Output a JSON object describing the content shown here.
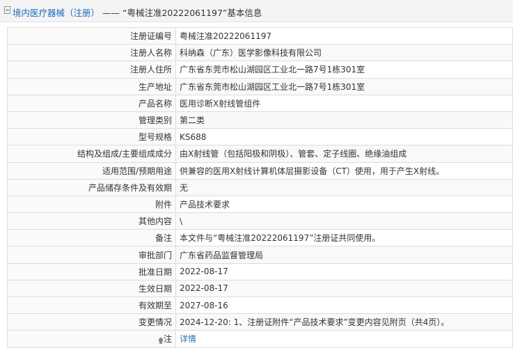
{
  "header": {
    "crumb_main": "境内医疗器械（注册）",
    "crumb_sep": " —— ",
    "crumb_sub": "“粤械注准20222061197”基本信息"
  },
  "rows": [
    {
      "label": "注册证编号",
      "value": "粤械注准20222061197"
    },
    {
      "label": "注册人名称",
      "value": "科纳森（广东）医学影像科技有限公司"
    },
    {
      "label": "注册人住所",
      "value": "广东省东莞市松山湖园区工业北一路7号1栋301室"
    },
    {
      "label": "生产地址",
      "value": "广东省东莞市松山湖园区工业北一路7号1栋301室"
    },
    {
      "label": "产品名称",
      "value": "医用诊断X射线管组件"
    },
    {
      "label": "管理类别",
      "value": "第二类"
    },
    {
      "label": "型号规格",
      "value": "KS688"
    },
    {
      "label": "结构及组成/主要组成成分",
      "value": "由X射线管（包括阳极和阴极）、管套、定子线圈、绝缘油组成"
    },
    {
      "label": "适用范围/预期用途",
      "value": "供兼容的医用X射线计算机体层摄影设备（CT）使用，用于产生X射线。"
    },
    {
      "label": "产品储存条件及有效期",
      "value": "无"
    },
    {
      "label": "附件",
      "value": "产品技术要求"
    },
    {
      "label": "其他内容",
      "value": "\\"
    },
    {
      "label": "备注",
      "value": "本文件与“粤械注准20222061197”注册证共同使用。"
    },
    {
      "label": "审批部门",
      "value": "广东省药品监督管理局"
    },
    {
      "label": "批准日期",
      "value": "2022-08-17"
    },
    {
      "label": "生效日期",
      "value": "2022-08-17"
    },
    {
      "label": "有效期至",
      "value": "2027-08-16"
    },
    {
      "label": "变更情况",
      "value": "2024-12-20: 1、注册证附件“产品技术要求”变更内容见附页（共4页）。"
    }
  ],
  "note_row": {
    "label": "注",
    "icon": "lightbulb-icon",
    "link": "详情"
  }
}
